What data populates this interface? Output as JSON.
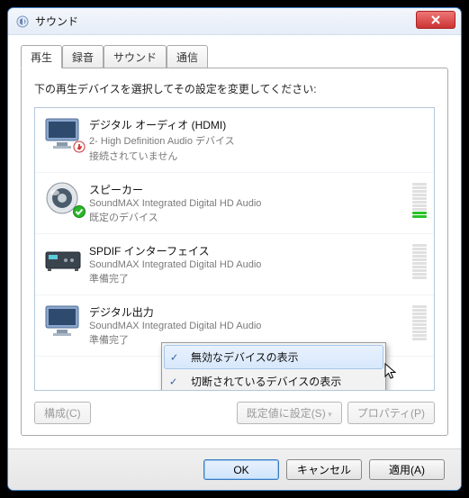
{
  "window": {
    "title": "サウンド"
  },
  "tabs": [
    "再生",
    "録音",
    "サウンド",
    "通信"
  ],
  "active_tab": 0,
  "instruction": "下の再生デバイスを選択してその設定を変更してください:",
  "devices": [
    {
      "name": "デジタル オーディオ (HDMI)",
      "subtitle": "2- High Definition Audio デバイス",
      "status": "接続されていません",
      "icon": "monitor",
      "badge": "down-red",
      "level_on": 0,
      "level_enabled": false
    },
    {
      "name": "スピーカー",
      "subtitle": "SoundMAX Integrated Digital HD Audio",
      "status": "既定のデバイス",
      "icon": "speaker",
      "badge": "check-green",
      "level_on": 2,
      "level_enabled": true
    },
    {
      "name": "SPDIF インターフェイス",
      "subtitle": "SoundMAX Integrated Digital HD Audio",
      "status": "準備完了",
      "icon": "receiver",
      "badge": null,
      "level_on": 0,
      "level_enabled": true
    },
    {
      "name": "デジタル出力",
      "subtitle": "SoundMAX Integrated Digital HD Audio",
      "status": "準備完了",
      "icon": "monitor",
      "badge": null,
      "level_on": 0,
      "level_enabled": true
    }
  ],
  "buttons": {
    "configure": "構成(C)",
    "set_default": "既定値に設定(S)",
    "properties": "プロパティ(P)"
  },
  "dialog_buttons": {
    "ok": "OK",
    "cancel": "キャンセル",
    "apply": "適用(A)"
  },
  "context_menu": {
    "items": [
      {
        "label": "無効なデバイスの表示",
        "checked": true,
        "hover": true
      },
      {
        "label": "切断されているデバイスの表示",
        "checked": true,
        "hover": false
      }
    ]
  }
}
